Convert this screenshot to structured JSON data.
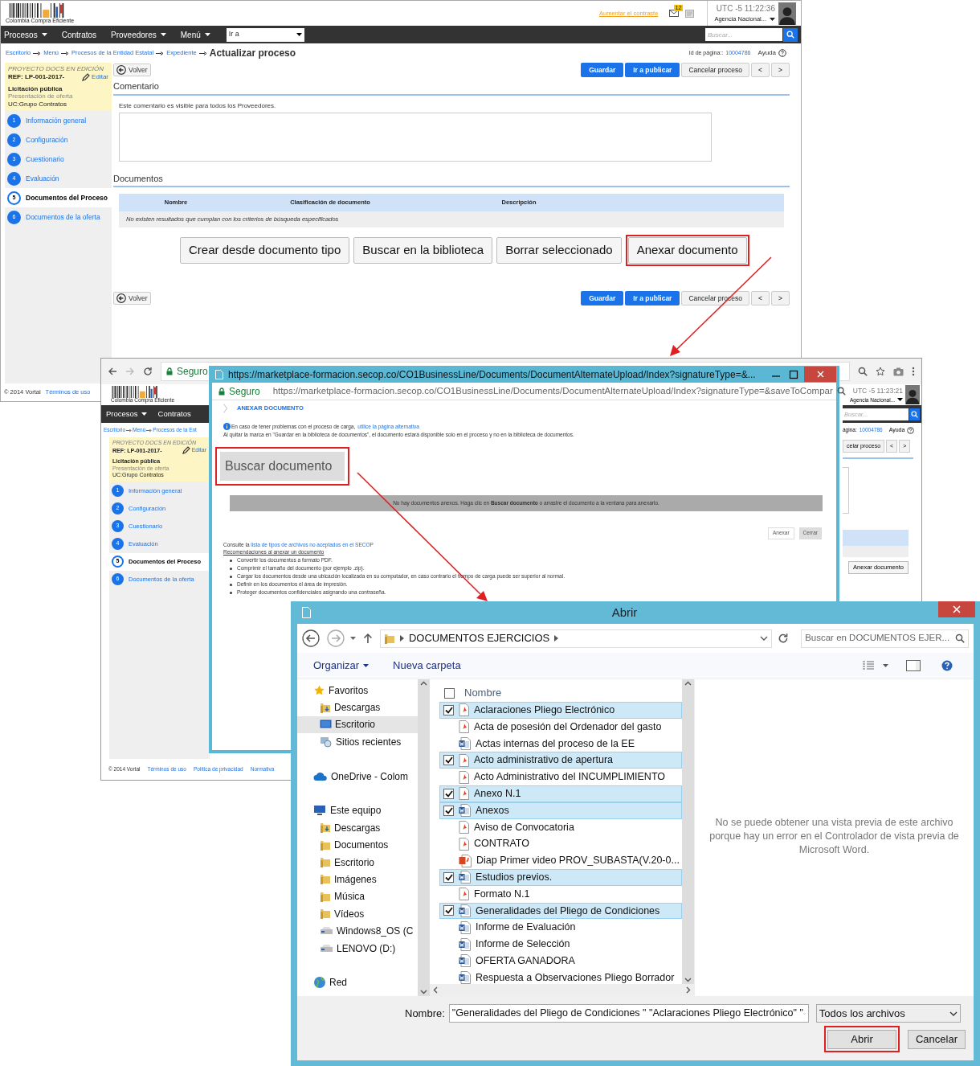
{
  "main_page": {
    "header": {
      "logo_text": "Colombia Compra Eficiente",
      "contrast_link": "Aumentar el contraste",
      "mail_badge": "12",
      "time": "UTC -5 11:22:36",
      "agency": "Agencia Nacional..."
    },
    "nav": {
      "menus": [
        {
          "label": "Procesos",
          "dropdown": true
        },
        {
          "label": "Contratos",
          "dropdown": false
        },
        {
          "label": "Proveedores",
          "dropdown": true
        },
        {
          "label": "Menú",
          "dropdown": true
        }
      ],
      "goto_select": "Ir a",
      "search_placeholder": "Buscar..."
    },
    "breadcrumb": [
      "Escritorio",
      "Menú",
      "Procesos de la Entidad Estatal",
      "Expediente"
    ],
    "page_title": "Actualizar proceso",
    "page_id_label": "Id de página::",
    "page_id": "10004786",
    "help": "Ayuda",
    "process": {
      "status": "PROYECTO DOCS EN EDICIÓN",
      "ref": "REF: LP-001-2017-",
      "edit": "Editar",
      "type": "Licitación pública",
      "phase": "Presentación de oferta",
      "unit": "UC:Grupo Contratos"
    },
    "steps": [
      {
        "number": "1",
        "label": "Información general",
        "selected": false
      },
      {
        "number": "2",
        "label": "Configuración",
        "selected": false
      },
      {
        "number": "3",
        "label": "Cuestionario",
        "selected": false
      },
      {
        "number": "4",
        "label": "Evaluación",
        "selected": false
      },
      {
        "number": "5",
        "label": "Documentos del Proceso",
        "selected": true
      },
      {
        "number": "6",
        "label": "Documentos de la oferta",
        "selected": false
      }
    ],
    "back_button": "Volver",
    "actions": [
      {
        "label": "Guardar",
        "kind": "primary"
      },
      {
        "label": "Ir a publicar",
        "kind": "primary"
      },
      {
        "label": "Cancelar proceso",
        "kind": "secondary"
      },
      {
        "label": "<",
        "kind": "secondary"
      },
      {
        "label": ">",
        "kind": "secondary"
      }
    ],
    "comment": {
      "heading": "Comentario",
      "hint": "Este comentario es visible para todos los Proveedores."
    },
    "documents": {
      "heading": "Documentos",
      "columns": [
        "Nombre",
        "Clasificación de documento",
        "Descripción"
      ],
      "empty_message": "No existen resultados que cumplan con los criterios de búsqueda especificados"
    },
    "document_buttons": [
      {
        "label": "Crear desde documento tipo",
        "highlighted": false
      },
      {
        "label": "Buscar en la biblioteca",
        "highlighted": false
      },
      {
        "label": "Borrar seleccionado",
        "highlighted": false
      },
      {
        "label": "Anexar documento",
        "highlighted": true
      }
    ],
    "bottom_back_button": "Volver",
    "bottom_actions": [
      {
        "label": "Guardar",
        "kind": "primary"
      },
      {
        "label": "Ir a publicar",
        "kind": "primary"
      },
      {
        "label": "Cancelar proceso",
        "kind": "secondary"
      },
      {
        "label": "<",
        "kind": "secondary"
      },
      {
        "label": ">",
        "kind": "secondary"
      }
    ],
    "footer": [
      "© 2014 Vortal",
      "Términos de uso"
    ]
  },
  "back_browser": {
    "address_security": "Seguro",
    "logo_text": "Colombia Compra Eficiente",
    "time": "UTC -5 11:23:21",
    "agency": "Agencia Nacional...",
    "nav_menus": [
      {
        "label": "Procesos",
        "dropdown": true
      },
      {
        "label": "Contratos",
        "dropdown": false
      }
    ],
    "search_placeholder": "Buscar...",
    "breadcrumb": [
      "Escritorio",
      "Menú",
      "Procesos de la Ent"
    ],
    "process": {
      "status": "PROYECTO DOCS EN EDICIÓN",
      "ref": "REF: LP-001-2017-",
      "edit": "Editar",
      "type": "Licitación pública",
      "phase": "Presentación de oferta",
      "unit": "UC:Grupo Contratos"
    },
    "steps": [
      {
        "number": "1",
        "label": "Información general",
        "selected": false
      },
      {
        "number": "2",
        "label": "Configuración",
        "selected": false
      },
      {
        "number": "3",
        "label": "Cuestionario",
        "selected": false
      },
      {
        "number": "4",
        "label": "Evaluación",
        "selected": false
      },
      {
        "number": "5",
        "label": "Documentos del Proceso",
        "selected": true
      },
      {
        "number": "6",
        "label": "Documentos de la oferta",
        "selected": false
      }
    ],
    "page_id_label": "ágina:",
    "page_id": "10004786",
    "help": "Ayuda",
    "actions": [
      "celar proceso",
      "<",
      ">"
    ],
    "document_button": "Anexar documento",
    "footer": [
      "© 2014 Vortal",
      "Términos de uso",
      "Política de privacidad",
      "Normativa"
    ]
  },
  "popup": {
    "title_url": "https://marketplace-formacion.secop.co/CO1BusinessLine/Documents/DocumentAlternateUpload/Index?signatureType=&...",
    "address_security": "Seguro",
    "address_url": "https://marketplace-formacion.secop.co/CO1BusinessLine/Documents/DocumentAlternateUpload/Index?signatureType=&saveToCompar",
    "heading": "ANEXAR DOCUMENTO",
    "info_text": "En caso de tener problemas con el proceso de carga,",
    "info_link": "utilice la página alternativa",
    "note": "Al quitar la marca en \"Guardar en la biblioteca de documentos\", el documento estará disponible solo en el proceso y no en la biblioteca de documentos.",
    "search_button": "Buscar documento",
    "drop_message": "No hay documentos anexos. Haga clic en **Buscar documento** o arrastre el documento a la ventana para anexarlo.",
    "buttons": [
      {
        "label": "Anexar",
        "kind": "outline"
      },
      {
        "label": "Cerrar",
        "kind": "filled"
      }
    ],
    "consult_text": "Consulte la",
    "consult_link": "lista de tipos de archivos no aceptados en el SECOP",
    "recommendations_title": "Recomendaciones al anexar un documento",
    "recommendations": [
      "Convertir los documentos a formato PDF.",
      "Comprimir el tamaño del documento (por ejemplo .zip).",
      "Cargar los documentos desde una ubicación localizada en su computador, en caso contrario el tiempo de carga puede ser superior al normal.",
      "Definir en los documentos el área de impresión.",
      "Proteger documentos confidenciales asignando una contraseña."
    ]
  },
  "dialog": {
    "title": "Abrir",
    "path": "DOCUMENTOS EJERCICIOS",
    "search_placeholder": "Buscar en DOCUMENTOS EJER...",
    "organize": "Organizar",
    "new_folder": "Nueva carpeta",
    "nav_tree": [
      {
        "label": "Favoritos",
        "kind": "star",
        "selected": false,
        "children": [
          {
            "label": "Descargas",
            "kind": "download",
            "selected": false
          },
          {
            "label": "Escritorio",
            "kind": "desktop",
            "selected": true
          },
          {
            "label": "Sitios recientes",
            "kind": "recent",
            "selected": false
          }
        ]
      },
      {
        "label": "OneDrive - Colom",
        "kind": "cloud",
        "selected": false
      },
      {
        "label": "Este equipo",
        "kind": "computer",
        "selected": false,
        "children": [
          {
            "label": "Descargas",
            "kind": "download",
            "selected": false
          },
          {
            "label": "Documentos",
            "kind": "folder",
            "selected": false
          },
          {
            "label": "Escritorio",
            "kind": "folder",
            "selected": false
          },
          {
            "label": "Imágenes",
            "kind": "folder",
            "selected": false
          },
          {
            "label": "Música",
            "kind": "folder",
            "selected": false
          },
          {
            "label": "Vídeos",
            "kind": "folder",
            "selected": false
          },
          {
            "label": "Windows8_OS (C",
            "kind": "drive",
            "selected": false
          },
          {
            "label": "LENOVO (D:)",
            "kind": "drive",
            "selected": false
          }
        ]
      },
      {
        "label": "Red",
        "kind": "network",
        "selected": false
      }
    ],
    "select_all_checked": false,
    "list_header": "Nombre",
    "files": [
      {
        "name": "Aclaraciones Pliego Electrónico",
        "kind": "pdf",
        "checked": true
      },
      {
        "name": "Acta de posesión del Ordenador del gasto",
        "kind": "pdf",
        "checked": false
      },
      {
        "name": "Actas internas del proceso de la EE",
        "kind": "word",
        "checked": false
      },
      {
        "name": "Acto administrativo de apertura",
        "kind": "pdf",
        "checked": true
      },
      {
        "name": "Acto Administrativo del INCUMPLIMIENTO",
        "kind": "pdf",
        "checked": false
      },
      {
        "name": "Anexo N.1",
        "kind": "pdf",
        "checked": true
      },
      {
        "name": "Anexos",
        "kind": "word",
        "checked": true
      },
      {
        "name": "Aviso de Convocatoria",
        "kind": "pdf",
        "checked": false
      },
      {
        "name": "CONTRATO",
        "kind": "pdf",
        "checked": false
      },
      {
        "name": "Diap Primer video PROV_SUBASTA(V.20-0...",
        "kind": "ppt",
        "checked": false
      },
      {
        "name": "Estudios previos.",
        "kind": "word",
        "checked": true
      },
      {
        "name": "Formato N.1",
        "kind": "pdf",
        "checked": false
      },
      {
        "name": "Generalidades del Pliego de Condiciones",
        "kind": "word",
        "checked": true
      },
      {
        "name": "Informe de Evaluación",
        "kind": "word",
        "checked": false
      },
      {
        "name": "Informe de Selección",
        "kind": "word",
        "checked": false
      },
      {
        "name": "OFERTA GANADORA",
        "kind": "word",
        "checked": false
      },
      {
        "name": "Respuesta a Observaciones Pliego Borrador",
        "kind": "word",
        "checked": false
      }
    ],
    "preview_message": "No se puede obtener una vista previa de este archivo porque hay un error en el Controlador de vista previa de Microsoft Word.",
    "filename_label": "Nombre:",
    "filename_value": "\"Generalidades del Pliego de Condiciones \" \"Aclaraciones Pliego Electrónico\" \"",
    "filter": "Todos los archivos",
    "buttons": [
      {
        "label": "Abrir",
        "highlighted": true
      },
      {
        "label": "Cancelar",
        "highlighted": false
      }
    ]
  }
}
